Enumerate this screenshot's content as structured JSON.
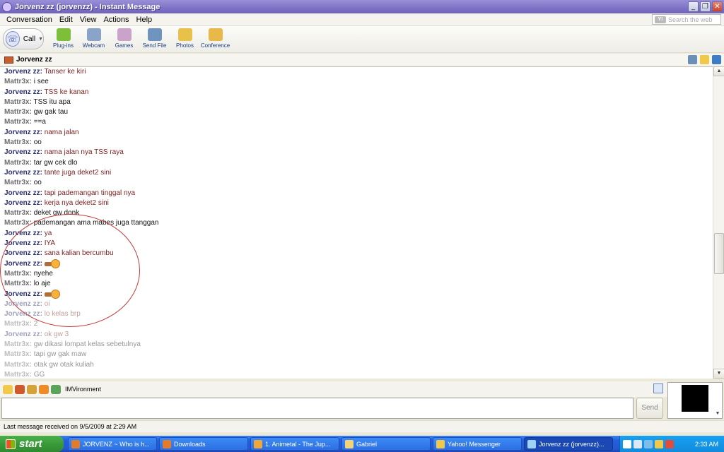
{
  "window": {
    "title": "Jorvenz zz (jorvenzz) - Instant Message",
    "buttons": [
      "_",
      "❐",
      "✕"
    ]
  },
  "menu": [
    "Conversation",
    "Edit",
    "View",
    "Actions",
    "Help"
  ],
  "search": {
    "placeholder": "Search the web",
    "logo": "Y!"
  },
  "toolbar": {
    "call_label": "Call",
    "tools": [
      {
        "label": "Plug-ins",
        "icon": "plugin-icon",
        "color": "#7dbf3a"
      },
      {
        "label": "Webcam",
        "icon": "webcam-icon",
        "color": "#8aa3c8"
      },
      {
        "label": "Games",
        "icon": "games-icon",
        "color": "#c9a3c9"
      },
      {
        "label": "Send File",
        "icon": "send-file-icon",
        "color": "#6f94bf"
      },
      {
        "label": "Photos",
        "icon": "photos-icon",
        "color": "#e7c14a"
      },
      {
        "label": "Conference",
        "icon": "conference-icon",
        "color": "#e8b949"
      }
    ]
  },
  "contact": {
    "name": "Jorvenz zz"
  },
  "messages": [
    {
      "sender": "Jorvenz zz:",
      "text": "Tanser ke kiri",
      "who": "jorvenz"
    },
    {
      "sender": "Mattr3x:",
      "text": "i see",
      "who": "mattr"
    },
    {
      "sender": "Jorvenz zz:",
      "text": "TSS ke kanan",
      "who": "jorvenz"
    },
    {
      "sender": "Mattr3x:",
      "text": "TSS itu apa",
      "who": "mattr"
    },
    {
      "sender": "Mattr3x:",
      "text": "gw gak tau",
      "who": "mattr"
    },
    {
      "sender": "Mattr3x:",
      "text": "==a",
      "who": "mattr"
    },
    {
      "sender": "Jorvenz zz:",
      "text": "nama jalan",
      "who": "jorvenz"
    },
    {
      "sender": "Mattr3x:",
      "text": "oo",
      "who": "mattr"
    },
    {
      "sender": "Jorvenz zz:",
      "text": "nama jalan nya TSS raya",
      "who": "jorvenz"
    },
    {
      "sender": "Mattr3x:",
      "text": "tar gw cek dlo",
      "who": "mattr"
    },
    {
      "sender": "Jorvenz zz:",
      "text": "tante juga deket2 sini",
      "who": "jorvenz"
    },
    {
      "sender": "Mattr3x:",
      "text": "oo",
      "who": "mattr"
    },
    {
      "sender": "Jorvenz zz:",
      "text": "tapi pademangan tinggal nya",
      "who": "jorvenz"
    },
    {
      "sender": "Jorvenz zz:",
      "text": "kerja nya deket2 sini",
      "who": "jorvenz"
    },
    {
      "sender": "Mattr3x:",
      "text": "deket gw donk",
      "who": "mattr"
    },
    {
      "sender": "Mattr3x:",
      "text": "pademangan ama mabes juga ttanggan",
      "who": "mattr"
    },
    {
      "sender": "Jorvenz zz:",
      "text": "ya",
      "who": "jorvenz"
    },
    {
      "sender": "Jorvenz zz:",
      "text": "IYA",
      "who": "jorvenz"
    },
    {
      "sender": "Jorvenz zz:",
      "text": "sana kalian bercumbu",
      "who": "jorvenz"
    },
    {
      "sender": "Jorvenz zz:",
      "text": "",
      "who": "jorvenz",
      "emoticon": true
    },
    {
      "sender": "Mattr3x:",
      "text": "nyehe",
      "who": "mattr"
    },
    {
      "sender": "Mattr3x:",
      "text": "lo aje",
      "who": "mattr"
    },
    {
      "sender": "Jorvenz zz:",
      "text": "",
      "who": "jorvenz",
      "emoticon": true
    },
    {
      "sender": "Jorvenz zz:",
      "text": "oi",
      "who": "jorvenz",
      "faded": true
    },
    {
      "sender": "Jorvenz zz:",
      "text": "lo kelas brp",
      "who": "jorvenz",
      "faded": true
    },
    {
      "sender": "Mattr3x:",
      "text": "2",
      "who": "mattr",
      "faded": true
    },
    {
      "sender": "Jorvenz zz:",
      "text": "ok gw 3",
      "who": "jorvenz",
      "faded": true
    },
    {
      "sender": "Mattr3x:",
      "text": "gw dikasi lompat kelas sebetulnya",
      "who": "mattr",
      "faded": true
    },
    {
      "sender": "Mattr3x:",
      "text": "tapi gw gak maw",
      "who": "mattr",
      "faded": true
    },
    {
      "sender": "Mattr3x:",
      "text": "otak gw otak kuliah",
      "who": "mattr",
      "faded": true
    },
    {
      "sender": "Mattr3x:",
      "text": "GG",
      "who": "mattr",
      "faded": true
    }
  ],
  "format_bar": {
    "imvironment_label": "IMVironment",
    "icons": [
      {
        "name": "emoticon-icon",
        "color": "#f2c84b"
      },
      {
        "name": "audible-icon",
        "color": "#d0592b"
      },
      {
        "name": "font-icon",
        "color": "#d5a23a"
      },
      {
        "name": "color-icon",
        "color": "#f08a24"
      },
      {
        "name": "imvironment-icon",
        "color": "#5aa35a"
      }
    ]
  },
  "send_label": "Send",
  "status": "Last message received on 9/5/2009 at 2:29 AM",
  "taskbar": {
    "start_label": "start",
    "tasks": [
      {
        "label": "JORVENZ ~ Who is h...",
        "color": "#e27b2c",
        "active": false
      },
      {
        "label": "Downloads",
        "color": "#e27b2c",
        "active": false
      },
      {
        "label": "1. Animetal - The Jup...",
        "color": "#f0a63a",
        "active": false
      },
      {
        "label": "Gabriel",
        "color": "#f4d27a",
        "active": false
      },
      {
        "label": "Yahoo! Messenger",
        "color": "#f2c84b",
        "active": false
      },
      {
        "label": "Jorvenz zz (jorvenzz)...",
        "color": "#9fd2f5",
        "active": true
      }
    ],
    "clock": "2:33 AM"
  }
}
